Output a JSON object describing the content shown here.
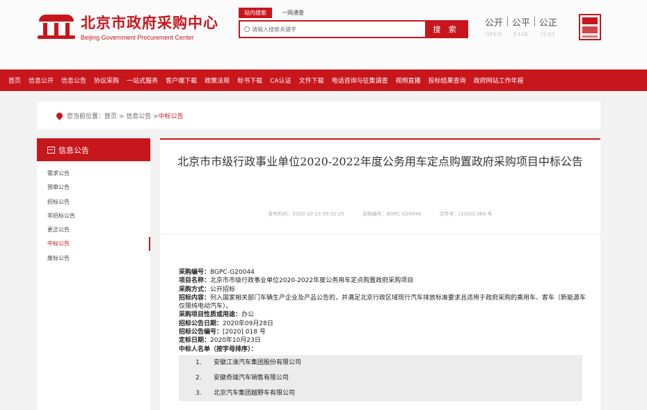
{
  "header": {
    "logo_cn": "北京市政府采购中心",
    "logo_en": "Beijing Government Procurement Center",
    "search_tabs": [
      "站内搜索",
      "一网通查"
    ],
    "search_placeholder": "请输入搜索关键字",
    "search_button": "搜 索",
    "slogans": [
      {
        "cn": "公开",
        "en": "OPEN"
      },
      {
        "cn": "公平",
        "en": "FAIR"
      },
      {
        "cn": "公正",
        "en": "JUST"
      }
    ]
  },
  "nav": [
    "首页",
    "信息公开",
    "信息公告",
    "协议采购",
    "一站式服务",
    "客户端下载",
    "政策法规",
    "标书下载",
    "CA认证",
    "文件下载",
    "电话咨询与征集调查",
    "视频直播",
    "投标结果查询",
    "政府网站工作年报"
  ],
  "breadcrumb": {
    "prefix": "您当前位置：首页 > 信息公告 > ",
    "current": "中标公告"
  },
  "sidebar": {
    "title": "信息公告",
    "items": [
      "需求公告",
      "预审公告",
      "招标公告",
      "非招标公告",
      "更正公告",
      "中标公告",
      "废标公告"
    ],
    "active_index": 5
  },
  "article": {
    "title": "北京市市级行政事业单位2020-2022年度公务用车定点购置政府采购项目中标公告",
    "meta": [
      "发布时间：2020-10-23 09:32:25",
      "采购编号：BGPC-G20044",
      "文件号：[2020] 064 号"
    ],
    "fields": [
      {
        "label": "采购编号：",
        "value": "BGPC-G20044"
      },
      {
        "label": "项目名称：",
        "value": "北京市市级行政事业单位2020-2022年度公务用车定点购置政府采购项目"
      },
      {
        "label": "采购方式：",
        "value": "公开招标"
      },
      {
        "label": "招标内容：",
        "value": "列入国家相关部门车辆生产企业及产品公告的，并满足北京行政区域现行汽车排放标准要求且适用于政府采购的乘用车、客车（新能源车仅限纯电动汽车）。"
      },
      {
        "label": "采购项目性质或用途：",
        "value": "办公"
      },
      {
        "label": "招标公告日期：",
        "value": "2020年09月28日"
      },
      {
        "label": "招标公告编号：",
        "value": "[2020] 018 号"
      },
      {
        "label": "定标日期：",
        "value": "2020年10月23日"
      },
      {
        "label": "中标人名单（按字母排序）：",
        "value": ""
      }
    ],
    "winners": [
      {
        "num": "1.",
        "name": "安徽江淮汽车集团股份有限公司"
      },
      {
        "num": "2.",
        "name": "安徽奇瑞汽车销售有限公司"
      },
      {
        "num": "3.",
        "name": "北京汽车集团越野车有限公司"
      }
    ]
  }
}
